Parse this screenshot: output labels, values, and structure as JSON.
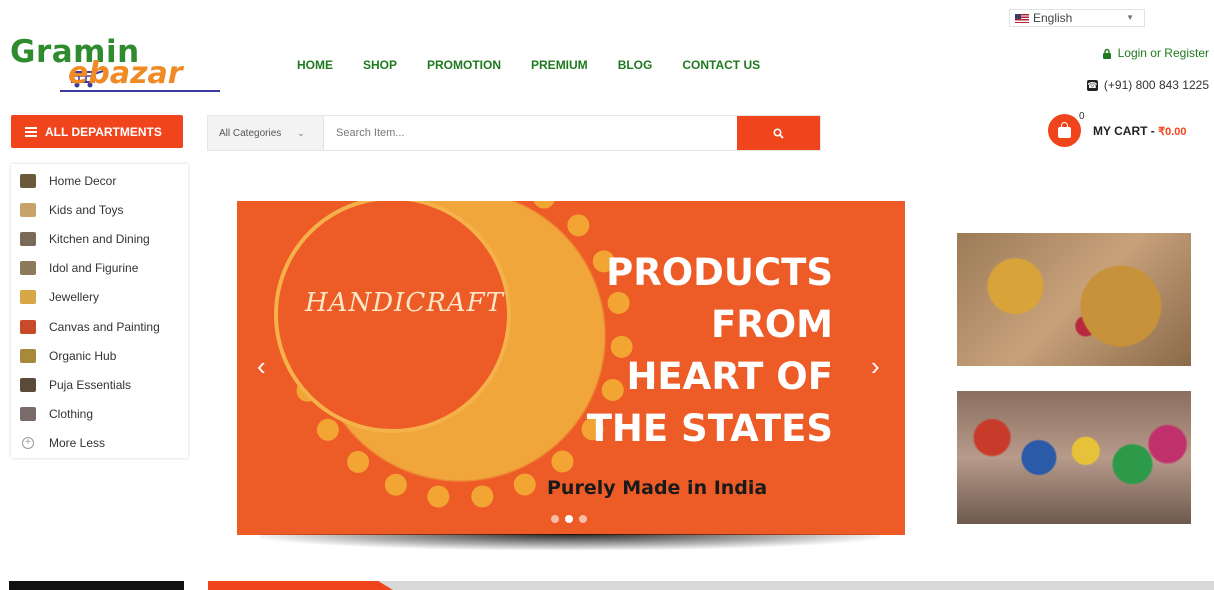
{
  "header": {
    "language": "English",
    "logo_top": "Gramin",
    "logo_bottom": "ebazar",
    "nav": [
      "HOME",
      "SHOP",
      "PROMOTION",
      "PREMIUM",
      "BLOG",
      "CONTACT US"
    ],
    "account": "Login or Register",
    "phone": "(+91) 800 843 1225"
  },
  "departments": {
    "button": "ALL DEPARTMENTS",
    "items": [
      {
        "label": "Home Decor",
        "icon": "home-decor-icon",
        "color": "#6b5a3a"
      },
      {
        "label": "Kids and Toys",
        "icon": "toys-icon",
        "color": "#c9a26a"
      },
      {
        "label": "Kitchen and Dining",
        "icon": "kitchen-icon",
        "color": "#7a6a5a"
      },
      {
        "label": "Idol and Figurine",
        "icon": "idol-icon",
        "color": "#8a7a5a"
      },
      {
        "label": "Jewellery",
        "icon": "jewellery-icon",
        "color": "#d8a848"
      },
      {
        "label": "Canvas and Painting",
        "icon": "painting-icon",
        "color": "#c84a2a"
      },
      {
        "label": "Organic Hub",
        "icon": "organic-icon",
        "color": "#a8883a"
      },
      {
        "label": "Puja Essentials",
        "icon": "puja-icon",
        "color": "#5a4a3a"
      },
      {
        "label": "Clothing",
        "icon": "clothing-icon",
        "color": "#7a6a6a"
      },
      {
        "label": "More Less",
        "icon": "plus-circle-icon",
        "color": "#ffffff"
      }
    ]
  },
  "search": {
    "category": "All Categories",
    "placeholder": "Search Item..."
  },
  "cart": {
    "count": "0",
    "label": "MY CART - ",
    "amount": "₹0.00"
  },
  "banner": {
    "script_text": "HANDICRAFT",
    "headline": [
      "PRODUCTS",
      "FROM",
      "HEART OF",
      "THE STATES"
    ],
    "tagline": "Purely Made in India",
    "slide_count": 3,
    "active_slide": 2
  },
  "colors": {
    "accent": "#f0441c",
    "nav_green": "#1f7a1f",
    "banner_orange": "#ed5b26"
  }
}
